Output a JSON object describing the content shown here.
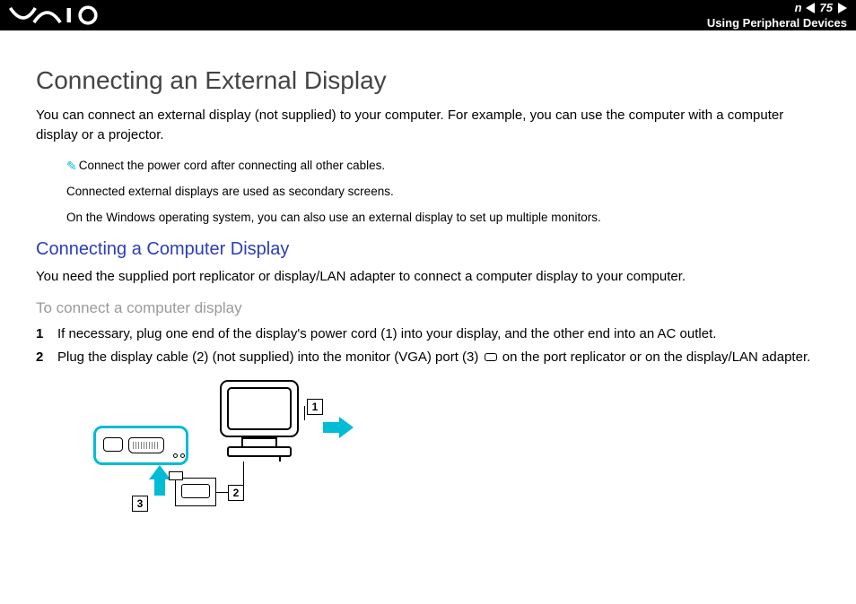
{
  "header": {
    "page_number": "75",
    "n_label": "n",
    "section_title": "Using Peripheral Devices"
  },
  "title": "Connecting an External Display",
  "intro": "You can connect an external display (not supplied) to your computer. For example, you can use the computer with a computer display or a projector.",
  "notes": {
    "line1": "Connect the power cord after connecting all other cables.",
    "line2": "Connected external displays are used as secondary screens.",
    "line3": "On the Windows operating system, you can also use an external display to set up multiple monitors."
  },
  "subheading": "Connecting a Computer Display",
  "sub_intro": "You need the supplied port replicator or display/LAN adapter to connect a computer display to your computer.",
  "procedure_heading": "To connect a computer display",
  "steps": {
    "s1_n": "1",
    "s1": "If necessary, plug one end of the display's power cord (1) into your display, and the other end into an AC outlet.",
    "s2_n": "2",
    "s2_a": "Plug the display cable (2) (not supplied) into the monitor (VGA) port (3) ",
    "s2_b": " on the port replicator or on the display/LAN adapter."
  },
  "callouts": {
    "c1": "1",
    "c2": "2",
    "c3": "3"
  }
}
